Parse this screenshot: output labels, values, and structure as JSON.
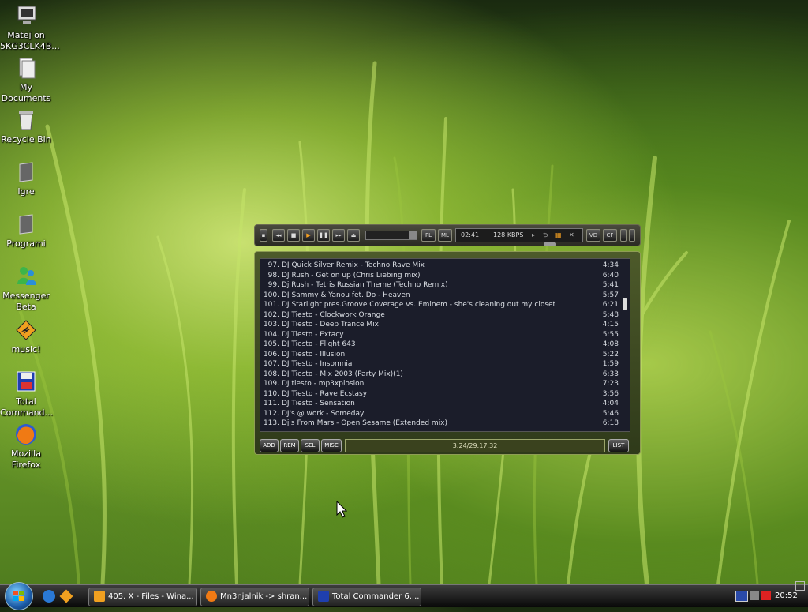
{
  "desktop": {
    "icons": [
      {
        "label": "Matej on 5KG3CLK4B...",
        "icon": "computer-icon"
      },
      {
        "label": "My Documents",
        "icon": "documents-icon"
      },
      {
        "label": "Recycle Bin",
        "icon": "recycle-bin-icon"
      },
      {
        "label": "Igre",
        "icon": "folder-icon"
      },
      {
        "label": "Programi",
        "icon": "folder-icon"
      },
      {
        "label": "Messenger Beta",
        "icon": "messenger-icon"
      },
      {
        "label": "music!",
        "icon": "winamp-icon"
      },
      {
        "label": "Total Command...",
        "icon": "total-commander-icon"
      },
      {
        "label": "Mozilla Firefox",
        "icon": "firefox-icon"
      }
    ]
  },
  "player": {
    "time": "02:41",
    "bitrate": "128 KBPS",
    "buttons": {
      "pl": "PL",
      "ml": "ML",
      "vd": "VD",
      "cf": "CF"
    },
    "playlist": [
      {
        "num": "97.",
        "title": "DJ Quick Silver Remix - Techno Rave Mix",
        "dur": "4:34"
      },
      {
        "num": "98.",
        "title": "DJ Rush - Get on up (Chris Liebing mix)",
        "dur": "6:40"
      },
      {
        "num": "99.",
        "title": "Dj Rush - Tetris Russian Theme (Techno Remix)",
        "dur": "5:41"
      },
      {
        "num": "100.",
        "title": "DJ Sammy & Yanou fet. Do - Heaven",
        "dur": "5:57"
      },
      {
        "num": "101.",
        "title": "DJ Starlight pres.Groove Coverage vs. Eminem - she's cleaning out my closet",
        "dur": "6:21"
      },
      {
        "num": "102.",
        "title": "DJ Tiesto - Clockwork Orange",
        "dur": "5:48"
      },
      {
        "num": "103.",
        "title": "DJ Tiesto - Deep Trance Mix",
        "dur": "4:15"
      },
      {
        "num": "104.",
        "title": "Dj Tiesto - Extacy",
        "dur": "5:55"
      },
      {
        "num": "105.",
        "title": "DJ Tiesto - Flight 643",
        "dur": "4:08"
      },
      {
        "num": "106.",
        "title": "DJ Tiesto - Illusion",
        "dur": "5:22"
      },
      {
        "num": "107.",
        "title": "DJ Tiesto - Insomnia",
        "dur": "1:59"
      },
      {
        "num": "108.",
        "title": "DJ Tiesto - Mix 2003 (Party Mix)(1)",
        "dur": "6:33"
      },
      {
        "num": "109.",
        "title": "DJ tiesto - mp3xplosion",
        "dur": "7:23"
      },
      {
        "num": "110.",
        "title": "DJ Tiesto - Rave Ecstasy",
        "dur": "3:56"
      },
      {
        "num": "111.",
        "title": "DJ Tiesto - Sensation",
        "dur": "4:04"
      },
      {
        "num": "112.",
        "title": "DJ's @ work - Someday",
        "dur": "5:46"
      },
      {
        "num": "113.",
        "title": "Dj's From Mars - Open Sesame (Extended mix)",
        "dur": "6:18"
      }
    ],
    "footer": {
      "add": "ADD",
      "rem": "REM",
      "sel": "SEL",
      "misc": "MISC",
      "status": "3:24/29:17:32",
      "list": "LIST"
    }
  },
  "taskbar": {
    "tasks": [
      {
        "label": "405. X - Files - Wina...",
        "icon": "winamp-icon"
      },
      {
        "label": "Mn3njalnik -> shran...",
        "icon": "firefox-icon"
      },
      {
        "label": "Total Commander 6....",
        "icon": "total-commander-icon"
      }
    ],
    "clock": "20:52"
  }
}
